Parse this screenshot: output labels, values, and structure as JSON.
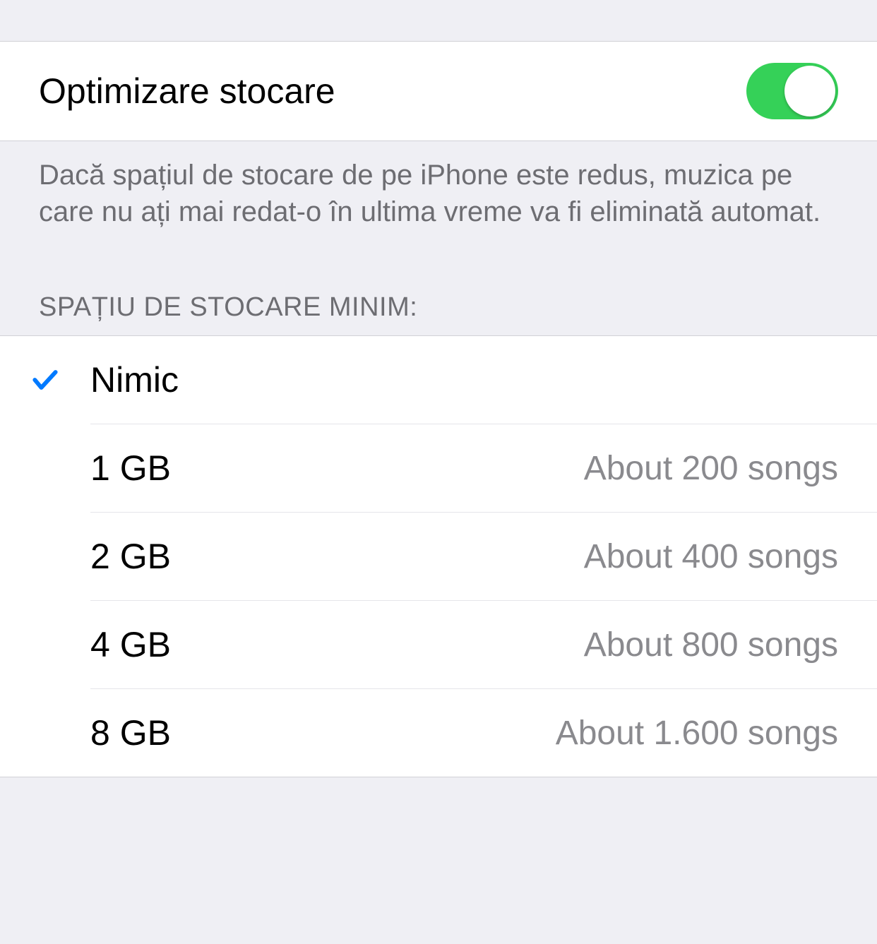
{
  "toggle": {
    "label": "Optimizare stocare",
    "on": true
  },
  "description": "Dacă spațiul de stocare de pe iPhone este redus, muzica pe care nu ați mai redat-o în ultima vreme va fi eliminată automat.",
  "section_header": "SPAȚIU DE STOCARE MINIM:",
  "options": [
    {
      "label": "Nimic",
      "detail": "",
      "selected": true
    },
    {
      "label": "1 GB",
      "detail": "About 200 songs",
      "selected": false
    },
    {
      "label": "2 GB",
      "detail": "About 400 songs",
      "selected": false
    },
    {
      "label": "4 GB",
      "detail": "About 800 songs",
      "selected": false
    },
    {
      "label": "8 GB",
      "detail": "About 1.600 songs",
      "selected": false
    }
  ]
}
